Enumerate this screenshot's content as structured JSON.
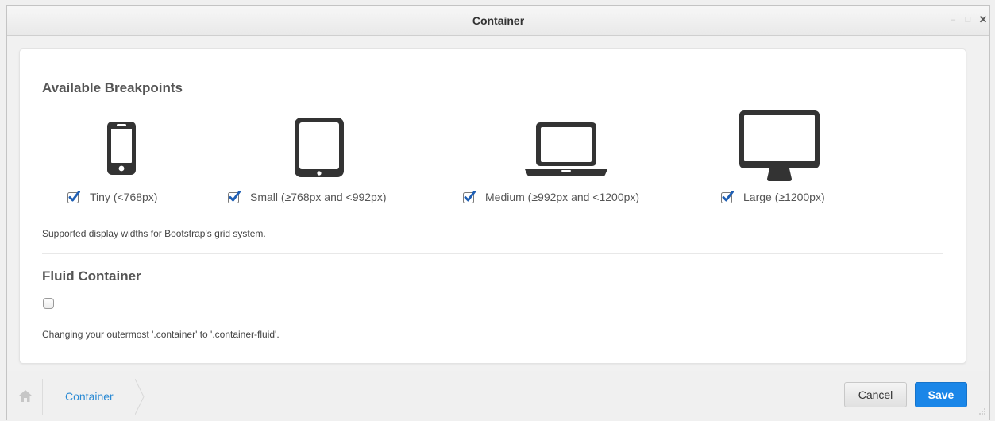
{
  "window": {
    "title": "Container",
    "controls": [
      "minimize",
      "maximize",
      "close"
    ]
  },
  "breakpoints": {
    "title": "Available Breakpoints",
    "options": [
      {
        "label": "Tiny (<768px)",
        "checked": true,
        "icon": "phone-icon"
      },
      {
        "label": "Small (≥768px and <992px)",
        "checked": true,
        "icon": "tablet-icon"
      },
      {
        "label": "Medium (≥992px and <1200px)",
        "checked": true,
        "icon": "laptop-icon"
      },
      {
        "label": "Large (≥1200px)",
        "checked": true,
        "icon": "desktop-icon"
      }
    ],
    "help": "Supported display widths for Bootstrap's grid system."
  },
  "fluid": {
    "title": "Fluid Container",
    "checked": false,
    "help": "Changing your outermost '.container' to '.container-fluid'."
  },
  "footer": {
    "breadcrumb": [
      "Container"
    ],
    "cancel_label": "Cancel",
    "save_label": "Save"
  },
  "colors": {
    "accent": "#1a86e8",
    "link": "#2a8ad4",
    "device_icon": "#333333",
    "checkbox": "#1f5fb4"
  }
}
